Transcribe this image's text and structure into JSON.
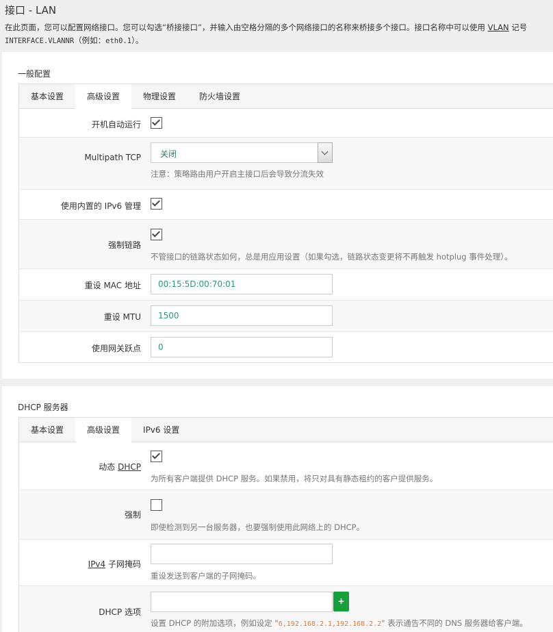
{
  "page": {
    "title": "接口 - LAN",
    "desc_part1": "在此页面，您可以配置网络接口。您可以勾选“桥接接口”，并输入由空格分隔的多个网络接口的名称来桥接多个接口。接口名称中可以使用 ",
    "desc_link": "VLAN",
    "desc_part2": " 记号",
    "desc_code": "INTERFACE.VLANNR",
    "desc_part3": "（例如：",
    "desc_code2": "eth0.1",
    "desc_part4": "）。"
  },
  "general": {
    "title": "一般配置",
    "tabs": [
      "基本设置",
      "高级设置",
      "物理设置",
      "防火墙设置"
    ],
    "active_tab": "高级设置",
    "autostart_label": "开机自动运行",
    "autostart_checked": true,
    "mptcp_label": "Multipath TCP",
    "mptcp_value": "关闭",
    "mptcp_hint": "注意：策略路由用户开启主接口后会导致分流失效",
    "ipv6_label": "使用内置的 IPv6 管理",
    "ipv6_checked": true,
    "force_link_label": "强制链路",
    "force_link_checked": true,
    "force_link_hint": "不管接口的链路状态如何，总是用应用设置（如果勾选，链路状态变更将不再触发 hotplug 事件处理）。",
    "mac_label": "重设 MAC 地址",
    "mac_value": "00:15:5D:00:70:01",
    "mtu_label": "重设 MTU",
    "mtu_value": "1500",
    "metric_label": "使用网关跃点",
    "metric_value": "0"
  },
  "dhcp": {
    "title": "DHCP 服务器",
    "tabs": [
      "基本设置",
      "高级设置",
      "IPv6 设置"
    ],
    "active_tab": "高级设置",
    "dynamic_label_prefix": "动态 ",
    "dynamic_label_link": "DHCP",
    "dynamic_checked": true,
    "dynamic_hint": "为所有客户端提供 DHCP 服务。如果禁用，将只对具有静态租约的客户提供服务。",
    "force_label": "强制",
    "force_checked": false,
    "force_hint": "即使检测到另一台服务器，也要强制使用此网络上的 DHCP。",
    "netmask_label_link": "IPv4",
    "netmask_label_suffix": " 子网掩码",
    "netmask_value": "",
    "netmask_hint": "重设发送到客户端的子网掩码。",
    "options_label": "DHCP 选项",
    "options_value": "",
    "options_add": "+",
    "options_hint_1": "设置 DHCP 的附加选项，例如设定 \"",
    "options_hint_code": "6,192.168.2.1,192.168.2.2",
    "options_hint_2": "\" 表示通告不同的 DNS 服务器给客户端。"
  },
  "colors": {
    "value_text": "#2a9a78",
    "add_button": "#17a03a",
    "hint_code": "#e8762b"
  }
}
